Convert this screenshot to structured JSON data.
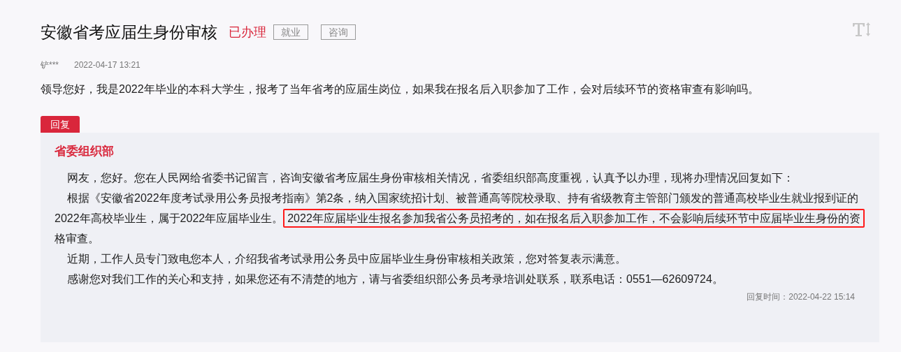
{
  "title": "安徽省考应届生身份审核",
  "status": "已办理",
  "tags": [
    "就业",
    "咨询"
  ],
  "author": "铲***",
  "time": "2022-04-17 13:21",
  "question": "领导您好，我是2022年毕业的本科大学生，报考了当年省考的应届生岗位，如果我在报名后入职参加了工作，会对后续环节的资格审查有影响吗。",
  "reply": {
    "label": "回复",
    "department": "省委组织部",
    "paragraphs": [
      [
        {
          "text": "网友，您好。您在人民网给省委书记留言，咨询安徽省考应届生身份审核相关情况，省委组织部高度重视，认真予以办理，现将办理情况回复如下：",
          "highlighted": false
        }
      ],
      [
        {
          "text": "根据《安徽省2022年度考试录用公务员报考指南》第2条，纳入国家统招计划、被普通高等院校录取、持有省级教育主管部门颁发的普通高校毕业生就业报到证的2022年高校毕业生，属于2022年应届毕业生。",
          "highlighted": false
        },
        {
          "text": "2022年应届毕业生报名参加我省公务员招考的，如在报名后入职参加工作，不会影响后续环节中应届毕业生身份的资",
          "highlighted": true
        },
        {
          "text": "格审查。",
          "highlighted": false
        }
      ],
      [
        {
          "text": "近期，工作人员专门致电您本人，介绍我省考试录用公务员中应届毕业生身份审核相关政策，您对答复表示满意。",
          "highlighted": false
        }
      ],
      [
        {
          "text": "感谢您对我们工作的关心和支持，如果您还有不清楚的地方，请与省委组织部公务员考录培训处联系，联系电话：0551—62609724。",
          "highlighted": false
        }
      ]
    ],
    "time": "回复时间：2022-04-22 15:14"
  }
}
